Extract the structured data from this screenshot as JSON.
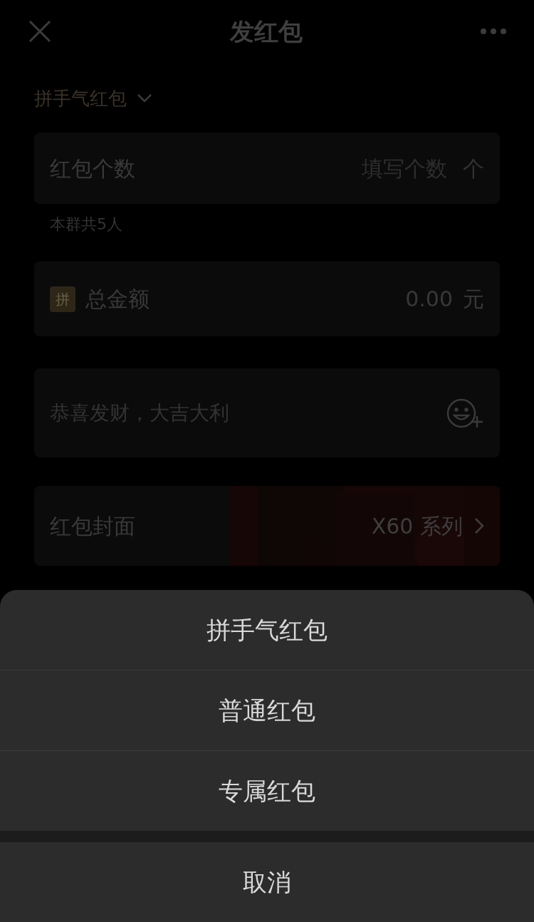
{
  "header": {
    "title": "发红包"
  },
  "type_selector": {
    "label": "拼手气红包"
  },
  "count_field": {
    "label": "红包个数",
    "placeholder": "填写个数",
    "unit": "个"
  },
  "member_note": "本群共5人",
  "amount_field": {
    "badge": "拼",
    "label": "总金额",
    "placeholder": "0.00",
    "unit": "元"
  },
  "greeting_field": {
    "placeholder": "恭喜发财，大吉大利"
  },
  "cover_row": {
    "label": "红包封面",
    "value": "X60 系列"
  },
  "action_sheet": {
    "options": [
      {
        "label": "拼手气红包"
      },
      {
        "label": "普通红包"
      },
      {
        "label": "专属红包"
      }
    ],
    "cancel": "取消"
  }
}
